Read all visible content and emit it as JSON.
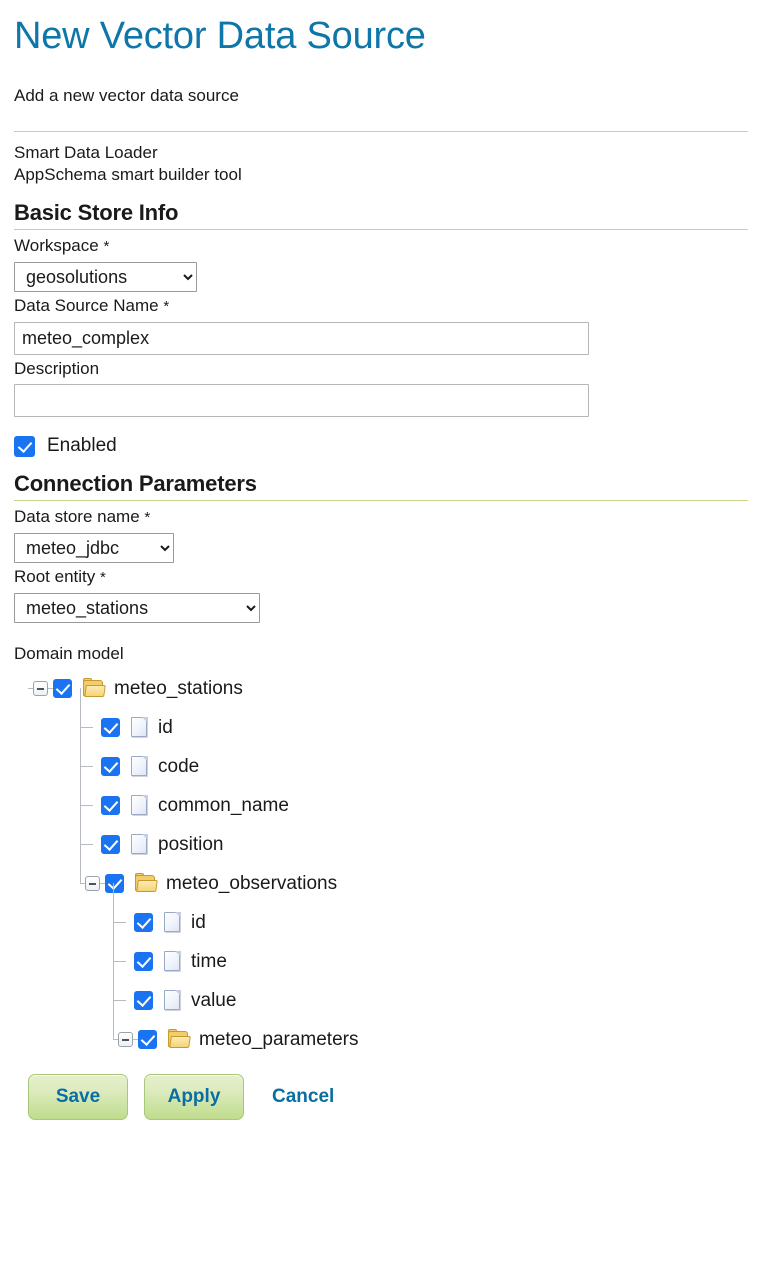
{
  "header": {
    "title": "New Vector Data Source",
    "subtitle": "Add a new vector data source",
    "tool_name": "Smart Data Loader",
    "tool_description": "AppSchema smart builder tool"
  },
  "basic_store_info": {
    "section_title": "Basic Store Info",
    "workspace": {
      "label": "Workspace",
      "required_marker": "*",
      "value": "geosolutions",
      "options": [
        "geosolutions"
      ]
    },
    "data_source_name": {
      "label": "Data Source Name",
      "required_marker": "*",
      "value": "meteo_complex",
      "placeholder": ""
    },
    "description": {
      "label": "Description",
      "value": "",
      "placeholder": ""
    },
    "enabled": {
      "label": "Enabled",
      "checked": true
    }
  },
  "connection_parameters": {
    "section_title": "Connection Parameters",
    "data_store_name": {
      "label": "Data store name",
      "required_marker": "*",
      "value": "meteo_jdbc",
      "options": [
        "meteo_jdbc"
      ]
    },
    "root_entity": {
      "label": "Root entity",
      "required_marker": "*",
      "value": "meteo_stations",
      "options": [
        "meteo_stations"
      ]
    },
    "domain_model": {
      "label": "Domain model",
      "nodes": [
        {
          "label": "meteo_stations",
          "icon": "folder-icon",
          "checked": true,
          "expanded": true,
          "depth": 0
        },
        {
          "label": "id",
          "icon": "file-icon",
          "checked": true,
          "expanded": null,
          "depth": 1
        },
        {
          "label": "code",
          "icon": "file-icon",
          "checked": true,
          "expanded": null,
          "depth": 1
        },
        {
          "label": "common_name",
          "icon": "file-icon",
          "checked": true,
          "expanded": null,
          "depth": 1
        },
        {
          "label": "position",
          "icon": "file-icon",
          "checked": true,
          "expanded": null,
          "depth": 1
        },
        {
          "label": "meteo_observations",
          "icon": "folder-icon",
          "checked": true,
          "expanded": true,
          "depth": 1
        },
        {
          "label": "id",
          "icon": "file-icon",
          "checked": true,
          "expanded": null,
          "depth": 2
        },
        {
          "label": "time",
          "icon": "file-icon",
          "checked": true,
          "expanded": null,
          "depth": 2
        },
        {
          "label": "value",
          "icon": "file-icon",
          "checked": true,
          "expanded": null,
          "depth": 2
        },
        {
          "label": "meteo_parameters",
          "icon": "folder-icon",
          "checked": true,
          "expanded": true,
          "depth": 2
        }
      ]
    }
  },
  "actions": {
    "save": "Save",
    "apply": "Apply",
    "cancel": "Cancel"
  },
  "colors": {
    "title_blue": "#0e76a8",
    "rule_green": "#c3d78a",
    "checkbox_blue": "#1a73f0",
    "button_green": "#bfdc8c",
    "link_blue": "#0a6ea3"
  }
}
